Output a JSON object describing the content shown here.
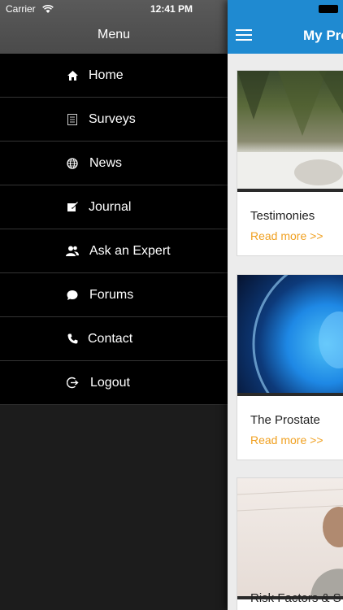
{
  "status_bar": {
    "carrier": "Carrier",
    "time": "12:41 PM"
  },
  "drawer": {
    "title": "Menu",
    "items": [
      {
        "label": "Home",
        "icon": "home-icon"
      },
      {
        "label": "Surveys",
        "icon": "survey-icon"
      },
      {
        "label": "News",
        "icon": "globe-icon"
      },
      {
        "label": "Journal",
        "icon": "journal-icon"
      },
      {
        "label": "Ask an Expert",
        "icon": "people-icon"
      },
      {
        "label": "Forums",
        "icon": "chat-icon"
      },
      {
        "label": "Contact",
        "icon": "phone-icon"
      },
      {
        "label": "Logout",
        "icon": "logout-icon"
      }
    ]
  },
  "content": {
    "title": "My Pro",
    "cards": [
      {
        "title": "Testimonies",
        "link": "Read more >>"
      },
      {
        "title": "The Prostate",
        "link": "Read more >>"
      },
      {
        "title": "Risk Factors & S",
        "link": ""
      }
    ]
  },
  "colors": {
    "accent": "#1f8ad1",
    "link": "#f0a020",
    "drawer_bg": "#000000"
  }
}
